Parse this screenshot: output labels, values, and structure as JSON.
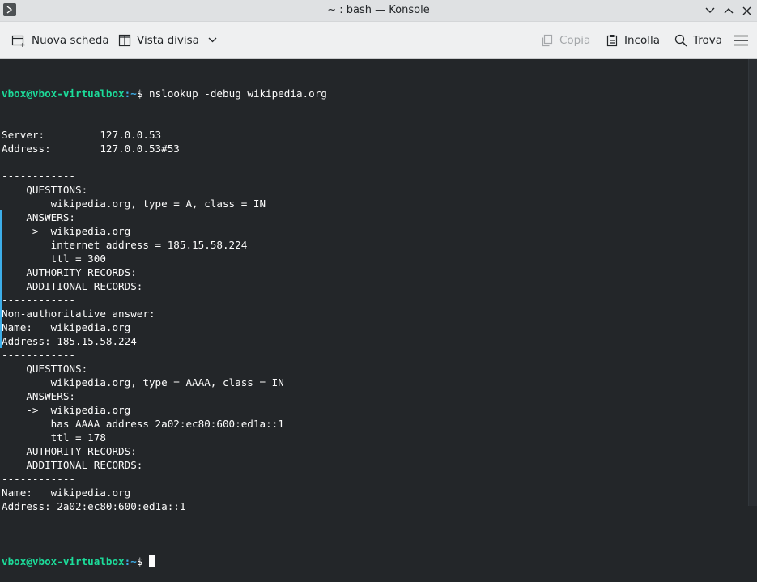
{
  "window": {
    "title": "~ : bash — Konsole"
  },
  "toolbar": {
    "new_tab": "Nuova scheda",
    "split_view": "Vista divisa",
    "copy": "Copia",
    "paste": "Incolla",
    "find": "Trova"
  },
  "prompt": {
    "user_host": "vbox@vbox-virtualbox",
    "path": ":~",
    "symbol": "$ "
  },
  "command": "nslookup -debug wikipedia.org",
  "output_lines": [
    "Server:         127.0.0.53",
    "Address:        127.0.0.53#53",
    "",
    "------------",
    "    QUESTIONS:",
    "        wikipedia.org, type = A, class = IN",
    "    ANSWERS:",
    "    ->  wikipedia.org",
    "        internet address = 185.15.58.224",
    "        ttl = 300",
    "    AUTHORITY RECORDS:",
    "    ADDITIONAL RECORDS:",
    "------------",
    "Non-authoritative answer:",
    "Name:   wikipedia.org",
    "Address: 185.15.58.224",
    "------------",
    "    QUESTIONS:",
    "        wikipedia.org, type = AAAA, class = IN",
    "    ANSWERS:",
    "    ->  wikipedia.org",
    "        has AAAA address 2a02:ec80:600:ed1a::1",
    "        ttl = 178",
    "    AUTHORITY RECORDS:",
    "    ADDITIONAL RECORDS:",
    "------------",
    "Name:   wikipedia.org",
    "Address: 2a02:ec80:600:ed1a::1",
    ""
  ],
  "colors": {
    "prompt_user": "#1cdc9a",
    "prompt_path": "#3daee9",
    "background": "#232629",
    "text": "#fcfcfc"
  }
}
